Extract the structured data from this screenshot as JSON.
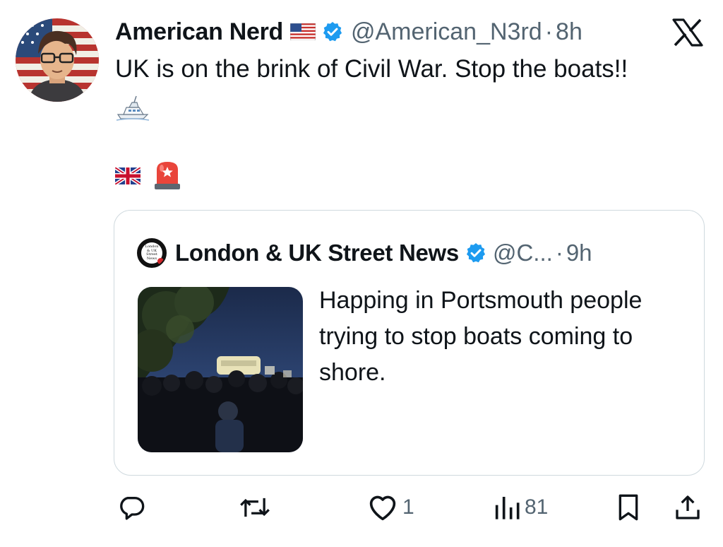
{
  "tweet": {
    "author_name": "American Nerd",
    "handle": "@American_N3rd",
    "separator": "·",
    "time": "8h",
    "text": "UK is on the brink of Civil War. Stop the boats!!",
    "emoji": [
      "speedboat",
      "uk-flag",
      "police-siren"
    ],
    "header_icons": [
      "us-flag",
      "verified-badge",
      "x-logo"
    ]
  },
  "quote": {
    "author_name": "London & UK Street News",
    "avatar_text": "London & UK Street News",
    "handle": "@C...",
    "separator": "·",
    "time": "9h",
    "text": "Happing in Portsmouth people trying to stop boats coming to shore."
  },
  "actions": {
    "reply_count": "",
    "retweet_count": "",
    "like_count": "1",
    "views_count": "81"
  },
  "colors": {
    "text": "#0f1419",
    "secondary": "#536471",
    "verified": "#1d9bf0",
    "border": "#cfd9de"
  }
}
